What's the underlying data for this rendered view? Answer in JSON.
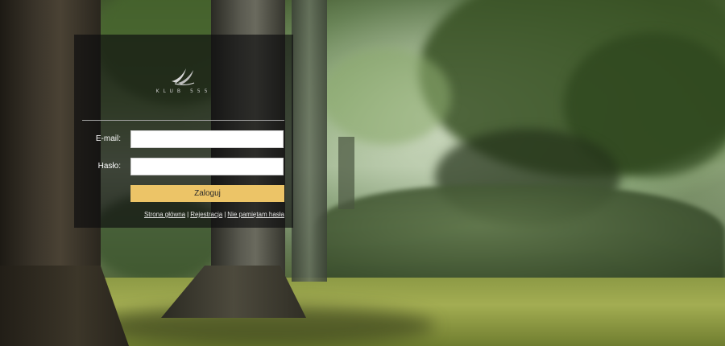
{
  "brand": {
    "logo_icon": "bird-logo-icon",
    "name": "KLUB 555"
  },
  "login_form": {
    "email_label": "E-mail:",
    "email_value": "",
    "password_label": "Hasło:",
    "password_value": "",
    "submit_label": "Zaloguj"
  },
  "links": {
    "home": "Strona główna",
    "separator": "|",
    "register": "Rejestracja",
    "forgot_password": "Nie pamiętam hasła"
  },
  "colors": {
    "panel_background": "#0c0c0e",
    "button_background": "#ecc467",
    "text": "#ffffff"
  }
}
